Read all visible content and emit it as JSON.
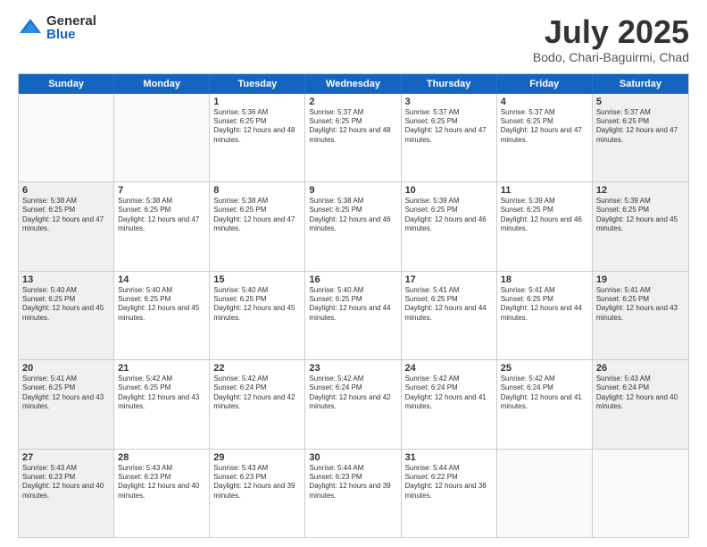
{
  "logo": {
    "general": "General",
    "blue": "Blue"
  },
  "title": {
    "month": "July 2025",
    "location": "Bodo, Chari-Baguirmi, Chad"
  },
  "days_of_week": [
    "Sunday",
    "Monday",
    "Tuesday",
    "Wednesday",
    "Thursday",
    "Friday",
    "Saturday"
  ],
  "weeks": [
    [
      {
        "day": "",
        "sunrise": "",
        "sunset": "",
        "daylight": "",
        "empty": true
      },
      {
        "day": "",
        "sunrise": "",
        "sunset": "",
        "daylight": "",
        "empty": true
      },
      {
        "day": "1",
        "sunrise": "Sunrise: 5:36 AM",
        "sunset": "Sunset: 6:25 PM",
        "daylight": "Daylight: 12 hours and 48 minutes."
      },
      {
        "day": "2",
        "sunrise": "Sunrise: 5:37 AM",
        "sunset": "Sunset: 6:25 PM",
        "daylight": "Daylight: 12 hours and 48 minutes."
      },
      {
        "day": "3",
        "sunrise": "Sunrise: 5:37 AM",
        "sunset": "Sunset: 6:25 PM",
        "daylight": "Daylight: 12 hours and 47 minutes."
      },
      {
        "day": "4",
        "sunrise": "Sunrise: 5:37 AM",
        "sunset": "Sunset: 6:25 PM",
        "daylight": "Daylight: 12 hours and 47 minutes."
      },
      {
        "day": "5",
        "sunrise": "Sunrise: 5:37 AM",
        "sunset": "Sunset: 6:25 PM",
        "daylight": "Daylight: 12 hours and 47 minutes."
      }
    ],
    [
      {
        "day": "6",
        "sunrise": "Sunrise: 5:38 AM",
        "sunset": "Sunset: 6:25 PM",
        "daylight": "Daylight: 12 hours and 47 minutes."
      },
      {
        "day": "7",
        "sunrise": "Sunrise: 5:38 AM",
        "sunset": "Sunset: 6:25 PM",
        "daylight": "Daylight: 12 hours and 47 minutes."
      },
      {
        "day": "8",
        "sunrise": "Sunrise: 5:38 AM",
        "sunset": "Sunset: 6:25 PM",
        "daylight": "Daylight: 12 hours and 47 minutes."
      },
      {
        "day": "9",
        "sunrise": "Sunrise: 5:38 AM",
        "sunset": "Sunset: 6:25 PM",
        "daylight": "Daylight: 12 hours and 46 minutes."
      },
      {
        "day": "10",
        "sunrise": "Sunrise: 5:39 AM",
        "sunset": "Sunset: 6:25 PM",
        "daylight": "Daylight: 12 hours and 46 minutes."
      },
      {
        "day": "11",
        "sunrise": "Sunrise: 5:39 AM",
        "sunset": "Sunset: 6:25 PM",
        "daylight": "Daylight: 12 hours and 46 minutes."
      },
      {
        "day": "12",
        "sunrise": "Sunrise: 5:39 AM",
        "sunset": "Sunset: 6:25 PM",
        "daylight": "Daylight: 12 hours and 45 minutes."
      }
    ],
    [
      {
        "day": "13",
        "sunrise": "Sunrise: 5:40 AM",
        "sunset": "Sunset: 6:25 PM",
        "daylight": "Daylight: 12 hours and 45 minutes."
      },
      {
        "day": "14",
        "sunrise": "Sunrise: 5:40 AM",
        "sunset": "Sunset: 6:25 PM",
        "daylight": "Daylight: 12 hours and 45 minutes."
      },
      {
        "day": "15",
        "sunrise": "Sunrise: 5:40 AM",
        "sunset": "Sunset: 6:25 PM",
        "daylight": "Daylight: 12 hours and 45 minutes."
      },
      {
        "day": "16",
        "sunrise": "Sunrise: 5:40 AM",
        "sunset": "Sunset: 6:25 PM",
        "daylight": "Daylight: 12 hours and 44 minutes."
      },
      {
        "day": "17",
        "sunrise": "Sunrise: 5:41 AM",
        "sunset": "Sunset: 6:25 PM",
        "daylight": "Daylight: 12 hours and 44 minutes."
      },
      {
        "day": "18",
        "sunrise": "Sunrise: 5:41 AM",
        "sunset": "Sunset: 6:25 PM",
        "daylight": "Daylight: 12 hours and 44 minutes."
      },
      {
        "day": "19",
        "sunrise": "Sunrise: 5:41 AM",
        "sunset": "Sunset: 6:25 PM",
        "daylight": "Daylight: 12 hours and 43 minutes."
      }
    ],
    [
      {
        "day": "20",
        "sunrise": "Sunrise: 5:41 AM",
        "sunset": "Sunset: 6:25 PM",
        "daylight": "Daylight: 12 hours and 43 minutes."
      },
      {
        "day": "21",
        "sunrise": "Sunrise: 5:42 AM",
        "sunset": "Sunset: 6:25 PM",
        "daylight": "Daylight: 12 hours and 43 minutes."
      },
      {
        "day": "22",
        "sunrise": "Sunrise: 5:42 AM",
        "sunset": "Sunset: 6:24 PM",
        "daylight": "Daylight: 12 hours and 42 minutes."
      },
      {
        "day": "23",
        "sunrise": "Sunrise: 5:42 AM",
        "sunset": "Sunset: 6:24 PM",
        "daylight": "Daylight: 12 hours and 42 minutes."
      },
      {
        "day": "24",
        "sunrise": "Sunrise: 5:42 AM",
        "sunset": "Sunset: 6:24 PM",
        "daylight": "Daylight: 12 hours and 41 minutes."
      },
      {
        "day": "25",
        "sunrise": "Sunrise: 5:42 AM",
        "sunset": "Sunset: 6:24 PM",
        "daylight": "Daylight: 12 hours and 41 minutes."
      },
      {
        "day": "26",
        "sunrise": "Sunrise: 5:43 AM",
        "sunset": "Sunset: 6:24 PM",
        "daylight": "Daylight: 12 hours and 40 minutes."
      }
    ],
    [
      {
        "day": "27",
        "sunrise": "Sunrise: 5:43 AM",
        "sunset": "Sunset: 6:23 PM",
        "daylight": "Daylight: 12 hours and 40 minutes."
      },
      {
        "day": "28",
        "sunrise": "Sunrise: 5:43 AM",
        "sunset": "Sunset: 6:23 PM",
        "daylight": "Daylight: 12 hours and 40 minutes."
      },
      {
        "day": "29",
        "sunrise": "Sunrise: 5:43 AM",
        "sunset": "Sunset: 6:23 PM",
        "daylight": "Daylight: 12 hours and 39 minutes."
      },
      {
        "day": "30",
        "sunrise": "Sunrise: 5:44 AM",
        "sunset": "Sunset: 6:23 PM",
        "daylight": "Daylight: 12 hours and 39 minutes."
      },
      {
        "day": "31",
        "sunrise": "Sunrise: 5:44 AM",
        "sunset": "Sunset: 6:22 PM",
        "daylight": "Daylight: 12 hours and 38 minutes."
      },
      {
        "day": "",
        "sunrise": "",
        "sunset": "",
        "daylight": "",
        "empty": true
      },
      {
        "day": "",
        "sunrise": "",
        "sunset": "",
        "daylight": "",
        "empty": true
      }
    ]
  ]
}
